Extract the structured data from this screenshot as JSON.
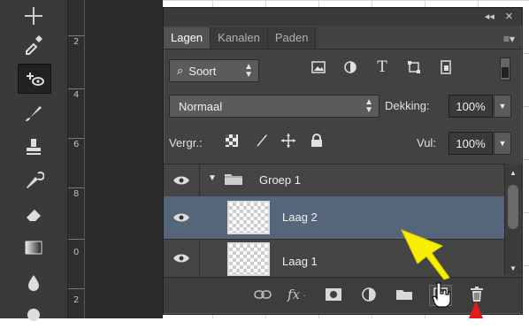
{
  "toolbar": {
    "tools": [
      "move-icon",
      "eyedropper-icon",
      "spot-healing-icon",
      "brush-icon",
      "stamp-icon",
      "history-brush-icon",
      "eraser-icon",
      "gradient-icon",
      "blur-icon",
      "dodge-icon"
    ],
    "active_tool_index": 2
  },
  "ruler": {
    "ticks": [
      "2",
      "4",
      "6",
      "8",
      "0",
      "2"
    ]
  },
  "panel": {
    "tabs": [
      {
        "label": "Lagen",
        "active": true
      },
      {
        "label": "Kanalen",
        "active": false
      },
      {
        "label": "Paden",
        "active": false
      }
    ],
    "filter_select": "Soort",
    "blend_mode": "Normaal",
    "opacity_label": "Dekking:",
    "opacity_value": "100%",
    "lock_label": "Vergr.:",
    "fill_label": "Vul:",
    "fill_value": "100%",
    "layers": [
      {
        "name": "Groep 1",
        "type": "group",
        "selected": false
      },
      {
        "name": "Laag 2",
        "type": "layer",
        "selected": true
      },
      {
        "name": "Laag 1",
        "type": "layer",
        "selected": false
      }
    ],
    "footer_icons": [
      "link-icon",
      "fx-icon",
      "mask-icon",
      "adjustment-icon",
      "folder-icon",
      "new-layer-icon",
      "trash-icon"
    ],
    "fx_label": "fx"
  },
  "colors": {
    "panel_bg": "#424242",
    "selected_layer": "#55657a",
    "annotation_arrow": "#f7ee00",
    "annotation_red": "#e01b1b"
  }
}
